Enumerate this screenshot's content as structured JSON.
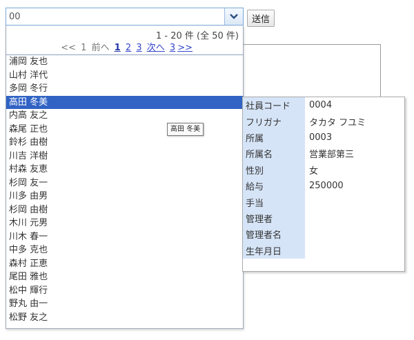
{
  "combo": {
    "value": "00",
    "dropdown_icon": "chevron-down-icon"
  },
  "send_button": {
    "label": "送信"
  },
  "pager": {
    "count_text": "1 - 20 件 (全 50 件)",
    "first": "<<",
    "first_page": "1",
    "prev": "前へ",
    "pages": [
      "1",
      "2",
      "3"
    ],
    "current_page": "1",
    "next": "次へ",
    "last_page": "3",
    "last": ">>"
  },
  "list": {
    "selected_index": 3,
    "items": [
      "浦岡 友也",
      "山村 洋代",
      "多岡 冬行",
      "高田 冬美",
      "内高 友之",
      "森尾 正也",
      "鈴杉 由樹",
      "川吉 洋樹",
      "村森 友恵",
      "杉岡 友一",
      "川多 由男",
      "杉岡 由樹",
      "木川 元男",
      "川木 春一",
      "中多 克也",
      "森村 正恵",
      "尾田 雅也",
      "松中 輝行",
      "野丸 由一",
      "松野 友之"
    ]
  },
  "tooltip": {
    "text": "高田 冬美"
  },
  "detail": {
    "rows": [
      {
        "label": "社員コード",
        "value": "0004"
      },
      {
        "label": "フリガナ",
        "value": "タカタ フユミ"
      },
      {
        "label": "所属",
        "value": "0003"
      },
      {
        "label": "所属名",
        "value": "営業部第三"
      },
      {
        "label": "性別",
        "value": "女"
      },
      {
        "label": "給与",
        "value": "250000"
      },
      {
        "label": "手当",
        "value": ""
      },
      {
        "label": "管理者",
        "value": ""
      },
      {
        "label": "管理者名",
        "value": ""
      },
      {
        "label": "生年月日",
        "value": ""
      }
    ]
  },
  "colors": {
    "selection": "#3063c4",
    "label_bg": "#d6e4f7",
    "link": "#3344cc"
  }
}
